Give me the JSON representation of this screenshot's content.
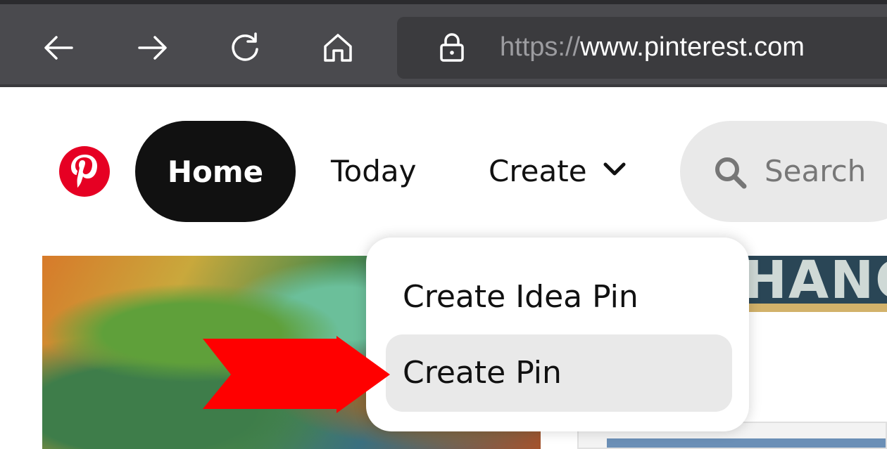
{
  "browser": {
    "url_protocol": "https://",
    "url_host": "www.pinterest.com",
    "icons": [
      "back-arrow-icon",
      "forward-arrow-icon",
      "refresh-icon",
      "home-icon",
      "lock-icon"
    ]
  },
  "header": {
    "nav": {
      "home": "Home",
      "today": "Today",
      "create": "Create"
    },
    "search_placeholder": "Search",
    "brand_color": "#e60023"
  },
  "dropdown": {
    "items": [
      {
        "label": "Create Idea Pin"
      },
      {
        "label": "Create Pin",
        "highlighted": true
      }
    ]
  },
  "content": {
    "right_pin_text": "HANC"
  },
  "annotation": {
    "arrow_color": "#ff0000"
  }
}
